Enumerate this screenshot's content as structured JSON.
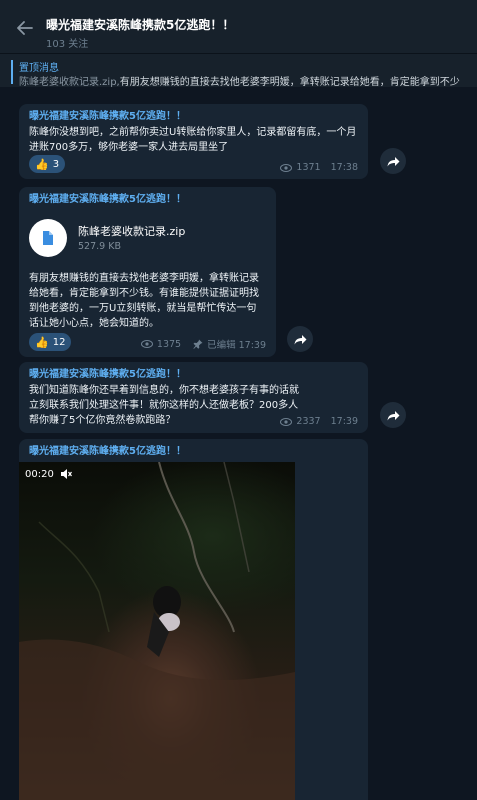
{
  "header": {
    "title": "曝光福建安溪陈峰携款5亿逃跑！！",
    "subtitle": "103 关注"
  },
  "pinned": {
    "title": "置顶消息",
    "text_highlight": "陈峰老婆收款记录.zip,",
    "text_rest": "有朋友想赚钱的直接去找他老婆李明媛，拿转账记录给她看，肯定能拿到不少"
  },
  "messages": [
    {
      "sender": "曝光福建安溪陈峰携款5亿逃跑！！",
      "text": "陈峰你没想到吧，之前帮你卖过U转账给你家里人，记录都留有底，一个月进账700多万，够你老婆一家人进去局里坐了",
      "reaction": {
        "emoji": "👍",
        "count": "3"
      },
      "views": "1371",
      "time": "17:38"
    },
    {
      "sender": "曝光福建安溪陈峰携款5亿逃跑！！",
      "file_name": "陈峰老婆收款记录.zip",
      "file_size": "527.9 KB",
      "text": "有朋友想赚钱的直接去找他老婆李明媛，拿转账记录给她看，肯定能拿到不少钱。有谁能提供证据证明找到他老婆的，一万U立刻转账，就当是帮忙传达一句话让她小心点，她会知道的。",
      "reaction": {
        "emoji": "👍",
        "count": "12"
      },
      "views": "1375",
      "edited": "已编辑 17:39"
    },
    {
      "sender": "曝光福建安溪陈峰携款5亿逃跑！！",
      "text": "我们知道陈峰你还早着到信息的，你不想老婆孩子有事的话就立刻联系我们处理这件事！就你这样的人还做老板？200多人帮你赚了5个亿你竟然卷款跑路？",
      "views": "2337",
      "time": "17:39"
    },
    {
      "sender": "曝光福建安溪陈峰携款5亿逃跑！！",
      "video_time": "00:20"
    }
  ],
  "icons": {
    "back": "arrow-left-icon",
    "file": "document-icon",
    "share": "share-arrow-icon",
    "views": "eye-icon",
    "pin": "pin-icon",
    "mute": "speaker-muted-icon"
  },
  "colors": {
    "background": "#0e1621",
    "header": "#17212b",
    "bubble": "#182533",
    "accent": "#5eaef0",
    "reaction": "#2b5278"
  }
}
